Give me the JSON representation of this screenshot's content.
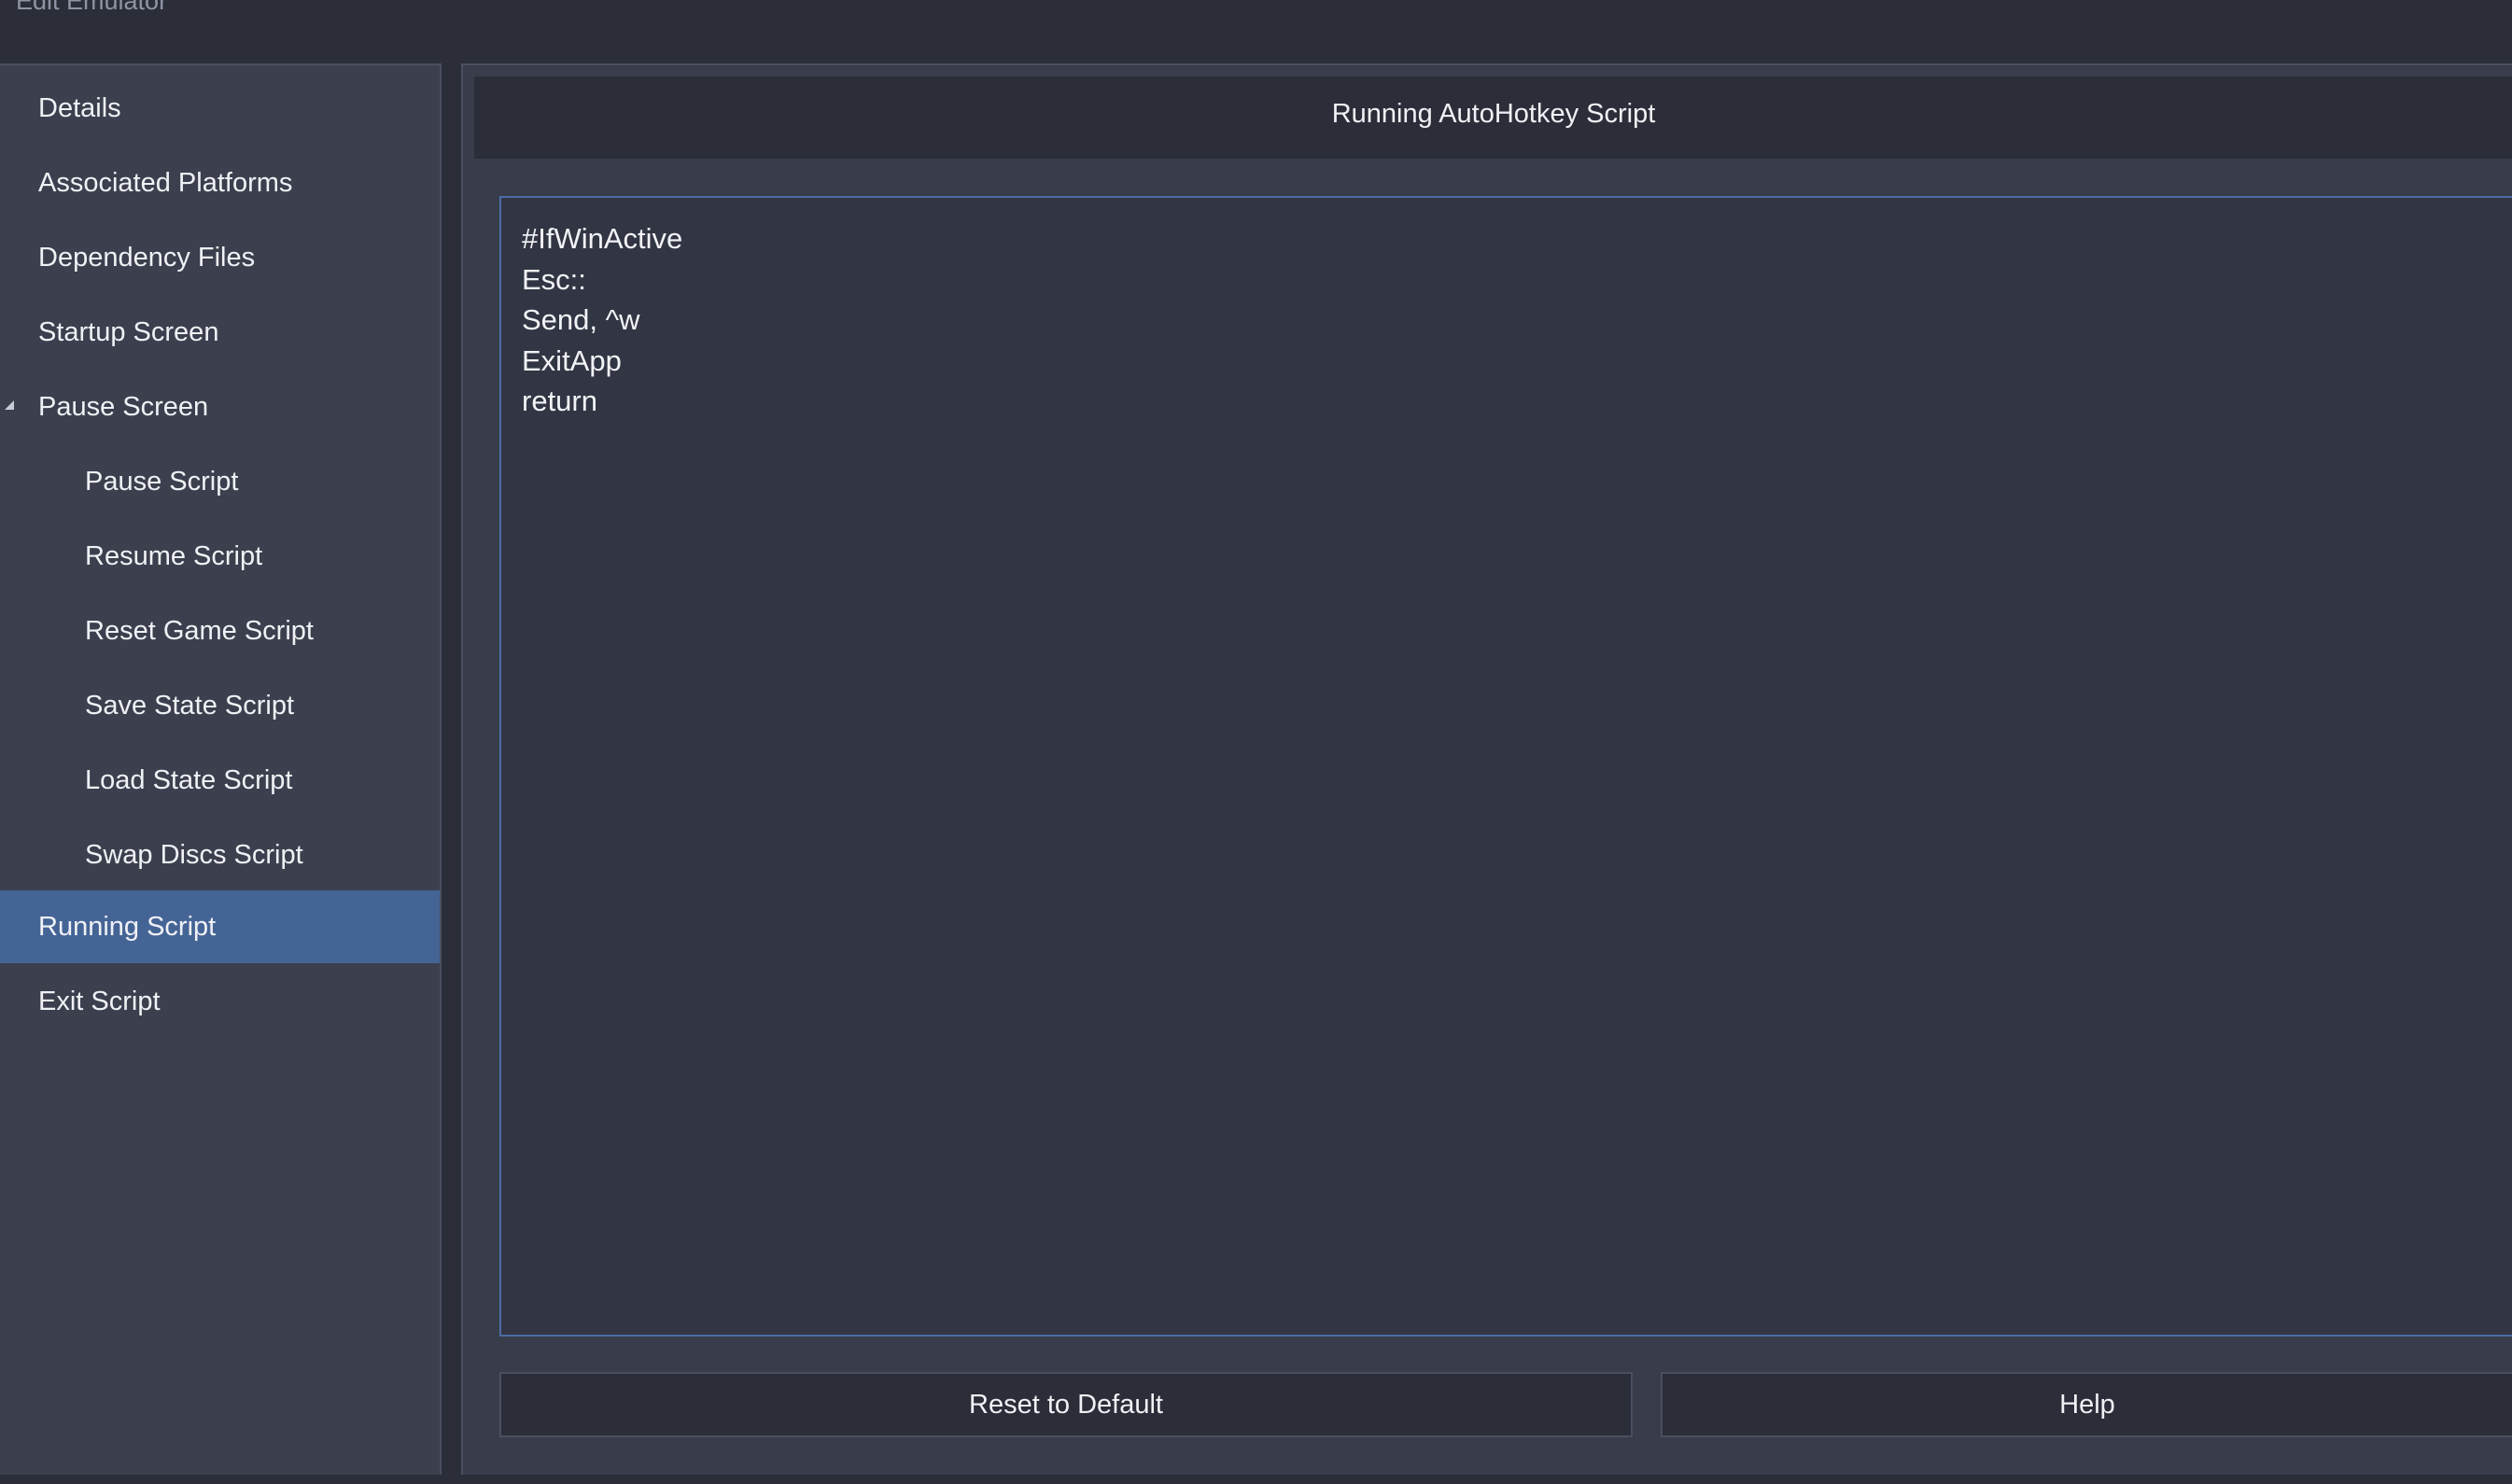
{
  "window": {
    "title": "Edit Emulator"
  },
  "sidebar": {
    "items": [
      {
        "label": "Details",
        "level": 1
      },
      {
        "label": "Associated Platforms",
        "level": 1
      },
      {
        "label": "Dependency Files",
        "level": 1
      },
      {
        "label": "Startup Screen",
        "level": 1
      },
      {
        "label": "Pause Screen",
        "level": 1,
        "expanded": true
      },
      {
        "label": "Pause Script",
        "level": 2
      },
      {
        "label": "Resume Script",
        "level": 2
      },
      {
        "label": "Reset Game Script",
        "level": 2
      },
      {
        "label": "Save State Script",
        "level": 2
      },
      {
        "label": "Load State Script",
        "level": 2
      },
      {
        "label": "Swap Discs Script",
        "level": 2
      },
      {
        "label": "Running Script",
        "level": 1,
        "selected": true
      },
      {
        "label": "Exit Script",
        "level": 1
      }
    ]
  },
  "main": {
    "header_title": "Running AutoHotkey Script",
    "script_text": "#IfWinActive\nEsc::\nSend, ^w\nExitApp\nreturn",
    "buttons": {
      "reset_label": "Reset to Default",
      "help_label": "Help"
    }
  },
  "colors": {
    "window_bg": "#2b2d38",
    "sidebar_bg": "#3b3f4e",
    "selected_bg": "#456496",
    "editor_border": "#4c6da6"
  }
}
